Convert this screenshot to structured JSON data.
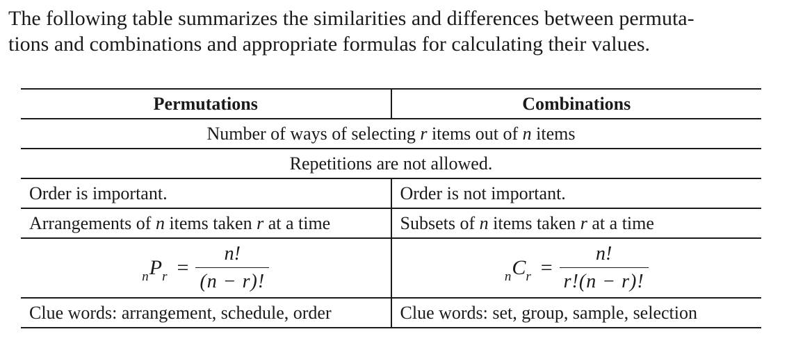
{
  "intro": {
    "line1": "The following table summarizes the similarities and differences between permuta-",
    "line2": "tions and combinations and appropriate formulas for calculating their values."
  },
  "table": {
    "headers": {
      "left": "Permutations",
      "right": "Combinations"
    },
    "shared_selection": {
      "before_r": "Number of ways of selecting ",
      "r": "r",
      "between": " items out of ",
      "n": "n",
      "after_n": " items"
    },
    "shared_repetition": "Repetitions are not allowed.",
    "order": {
      "left": "Order is important.",
      "right": "Order is not important."
    },
    "grouping": {
      "left": {
        "before_n": "Arrangements of ",
        "n": "n",
        "between": " items taken ",
        "r": "r",
        "after_r": " at a time"
      },
      "right": {
        "before_n": "Subsets of ",
        "n": "n",
        "between": " items taken ",
        "r": "r",
        "after_r": " at a time"
      }
    },
    "formulas": {
      "left": {
        "pre_sub": "n",
        "symbol": "P",
        "post_sub": "r",
        "equals": "=",
        "numerator": "n!",
        "denominator": "(n − r)!"
      },
      "right": {
        "pre_sub": "n",
        "symbol": "C",
        "post_sub": "r",
        "equals": "=",
        "numerator": "n!",
        "denominator": "r!(n − r)!"
      }
    },
    "clues": {
      "left": "Clue words: arrangement, schedule, order",
      "right": "Clue words: set, group, sample, selection"
    }
  }
}
